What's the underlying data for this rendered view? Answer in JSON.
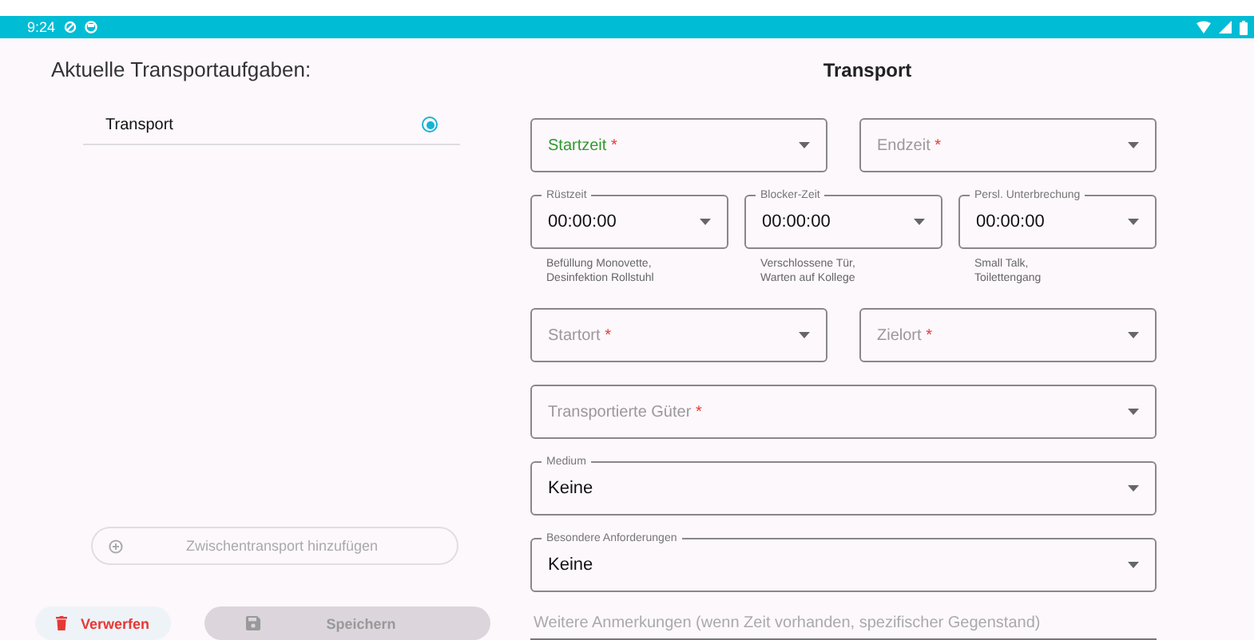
{
  "status_bar": {
    "time": "9:24"
  },
  "tasks_panel": {
    "title": "Aktuelle Transportaufgaben:",
    "tasks": [
      {
        "label": "Transport",
        "selected": true
      }
    ],
    "add_button": {
      "label": "Zwischentransport hinzufügen",
      "disabled": true
    },
    "discard_button": {
      "label": "Verwerfen",
      "disabled": false
    },
    "save_button": {
      "label": "Speichern",
      "disabled": true
    }
  },
  "form": {
    "title": "Transport",
    "rows": [
      [
        {
          "label": "Startzeit",
          "required_mark": "*",
          "highlighted": true
        },
        {
          "label": "Endzeit",
          "required_mark": "*",
          "highlighted": false
        }
      ],
      [
        {
          "label": "Rüstzeit",
          "value": "00:00:00",
          "helper": "Befüllung Monovette,\nDesinfektion Rollstuhl",
          "highlighted": false
        },
        {
          "label": "Blocker-Zeit",
          "value": "00:00:00",
          "helper": "Verschlossene Tür,\nWarten auf Kollege",
          "highlighted": false
        },
        {
          "label": "Persl. Unterbrechung",
          "value": "00:00:00",
          "helper": "Small Talk,\nToilettengang",
          "highlighted": false
        }
      ],
      [
        {
          "label": "Startort",
          "required_mark": "*",
          "highlighted": false
        },
        {
          "label": "Zielort",
          "required_mark": "*",
          "highlighted": false
        }
      ],
      [
        {
          "label": "Transportierte Güter",
          "required_mark": "*",
          "highlighted": false
        }
      ],
      [
        {
          "label": "Medium",
          "value": "Keine",
          "highlighted": false
        }
      ],
      [
        {
          "label": "Besondere Anforderungen",
          "value": "Keine",
          "highlighted": false
        }
      ]
    ],
    "notes": {
      "placeholder": "Weitere Anmerkungen (wenn Zeit vorhanden, spezifischer Gegenstand)"
    }
  }
}
